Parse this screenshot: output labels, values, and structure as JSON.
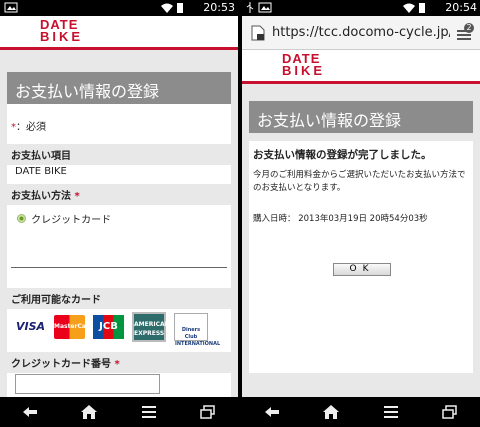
{
  "left": {
    "status_time": "20:53",
    "logo_line1": "DATE",
    "logo_line2": "BIKE",
    "section_title": "お支払い情報の登録",
    "required_star": "*",
    "required_note": "：必須",
    "payment_item_label": "お支払い項目",
    "payment_item_value": "DATE BIKE",
    "payment_method_label": "お支払い方法",
    "payment_method_option": "クレジットカード",
    "available_cards_label": "ご利用可能なカード",
    "cards": [
      "VISA",
      "MasterCard",
      "JCB",
      "AMERICAN EXPRESS",
      "Diners Club INTERNATIONAL"
    ],
    "card_number_label": "クレジットカード番号",
    "card_number_value": ""
  },
  "right": {
    "status_time": "20:54",
    "url": "https://tcc.docomo-cycle.jp/eco",
    "tab_count": "2",
    "logo_line1": "DATE",
    "logo_line2": "BIKE",
    "section_title": "お支払い情報の登録",
    "completion_title": "お支払い情報の登録が完了しました。",
    "completion_message": "今月のご利用料金からご選択いただいたお支払い方法でのお支払いとなります。",
    "purchase_date_label": "購入日時：",
    "purchase_date_value": "2013年03月19日 20時54分03秒",
    "ok_label": "OK"
  },
  "colors": {
    "brand_red": "#c8102e",
    "title_grey": "#8c8c8c"
  },
  "nav_icons": [
    "back-icon",
    "home-icon",
    "menu-icon",
    "recent-apps-icon"
  ]
}
